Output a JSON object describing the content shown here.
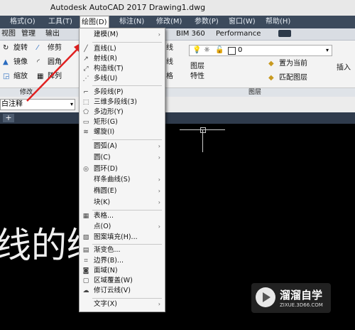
{
  "window": {
    "title": "Autodesk AutoCAD 2017    Drawing1.dwg"
  },
  "menubar": [
    {
      "label": "格式(O)"
    },
    {
      "label": "工具(T)"
    },
    {
      "label": "绘图(D)"
    },
    {
      "label": "标注(N)"
    },
    {
      "label": "修改(M)"
    },
    {
      "label": "参数(P)"
    },
    {
      "label": "窗口(W)"
    },
    {
      "label": "帮助(H)"
    }
  ],
  "ribbon_tabs": [
    {
      "label": "视图"
    },
    {
      "label": "管理"
    },
    {
      "label": "输出"
    },
    {
      "label": "BIM 360"
    },
    {
      "label": "Performance"
    }
  ],
  "ribbon": {
    "modify": {
      "rotate": "旋转",
      "trim": "修剪",
      "mirror": "镜像",
      "fillet": "圆角",
      "scale": "缩放",
      "array": "阵列"
    },
    "layer_value": "0",
    "layer_properties_line1": "图层",
    "layer_properties_line2": "特性",
    "set_current": "置为当前",
    "match_layer": "匹配图层",
    "insert": "插入",
    "partial_line": "线",
    "partial_grid": "格"
  },
  "panels": {
    "modify": "修改",
    "layer": "图层"
  },
  "annotation_combo": "白注释",
  "draw_menu": {
    "items": [
      {
        "label": "建模(M)",
        "icon": "",
        "submenu": true
      },
      {
        "label": "直线(L)",
        "icon": "line-icon",
        "submenu": false
      },
      {
        "label": "射线(R)",
        "icon": "ray-icon",
        "submenu": false
      },
      {
        "label": "构造线(T)",
        "icon": "xline-icon",
        "submenu": false
      },
      {
        "label": "多线(U)",
        "icon": "mline-icon",
        "submenu": false
      },
      {
        "label": "多段线(P)",
        "icon": "pline-icon",
        "submenu": false
      },
      {
        "label": "三维多段线(3)",
        "icon": "3dpoly-icon",
        "submenu": false
      },
      {
        "label": "多边形(Y)",
        "icon": "polygon-icon",
        "submenu": false
      },
      {
        "label": "矩形(G)",
        "icon": "rectangle-icon",
        "submenu": false
      },
      {
        "label": "螺旋(I)",
        "icon": "helix-icon",
        "submenu": false
      },
      {
        "label": "圆弧(A)",
        "icon": "",
        "submenu": true
      },
      {
        "label": "圆(C)",
        "icon": "",
        "submenu": true
      },
      {
        "label": "圆环(D)",
        "icon": "donut-icon",
        "submenu": false
      },
      {
        "label": "样条曲线(S)",
        "icon": "",
        "submenu": true
      },
      {
        "label": "椭圆(E)",
        "icon": "",
        "submenu": true
      },
      {
        "label": "块(K)",
        "icon": "",
        "submenu": true
      },
      {
        "label": "表格...",
        "icon": "table-icon",
        "submenu": false
      },
      {
        "label": "点(O)",
        "icon": "",
        "submenu": true
      },
      {
        "label": "图案填充(H)...",
        "icon": "hatch-icon",
        "submenu": false
      },
      {
        "label": "渐变色...",
        "icon": "gradient-icon",
        "submenu": false
      },
      {
        "label": "边界(B)...",
        "icon": "boundary-icon",
        "submenu": false
      },
      {
        "label": "面域(N)",
        "icon": "region-icon",
        "submenu": false
      },
      {
        "label": "区域覆盖(W)",
        "icon": "wipeout-icon",
        "submenu": false
      },
      {
        "label": "修订云线(V)",
        "icon": "revcloud-icon",
        "submenu": false
      },
      {
        "label": "文字(X)",
        "icon": "",
        "submenu": true
      }
    ]
  },
  "canvas_text": "线的绘",
  "watermark": {
    "title": "溜溜自学",
    "url": "ZIXUE.3D66.COM"
  },
  "colors": {
    "menubar": "#3c4a5c",
    "canvas": "#000000",
    "menu": "#f5f5f5",
    "arrow": "#e02020"
  }
}
